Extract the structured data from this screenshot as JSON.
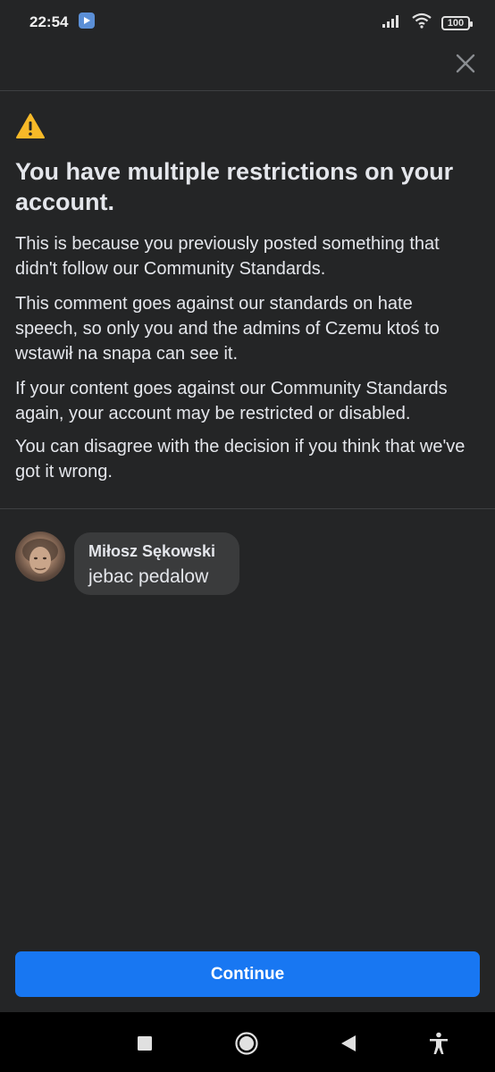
{
  "status_bar": {
    "time": "22:54",
    "battery": "100"
  },
  "dialog": {
    "title": "You have multiple restrictions on your account.",
    "paragraphs": [
      "This is because you previously posted something that didn't follow our Community Standards.",
      "This comment goes against our standards on hate speech, so only you and the admins of Czemu ktoś to wstawił na snapa can see it.",
      "If your content goes against our Community Standards again, your account may be restricted or disabled.",
      "You can disagree with the decision if you think that we've got it wrong."
    ],
    "comment": {
      "author": "Miłosz Sękowski",
      "text": "jebac pedalow"
    },
    "continue_label": "Continue"
  },
  "colors": {
    "background": "#242526",
    "accent": "#1877f2",
    "warning": "#f7b928",
    "bubble": "#3a3b3c"
  },
  "icons": {
    "close": "close-icon",
    "warning": "warning-icon",
    "nav": [
      "recents-icon",
      "home-icon",
      "back-icon",
      "accessibility-icon"
    ]
  }
}
